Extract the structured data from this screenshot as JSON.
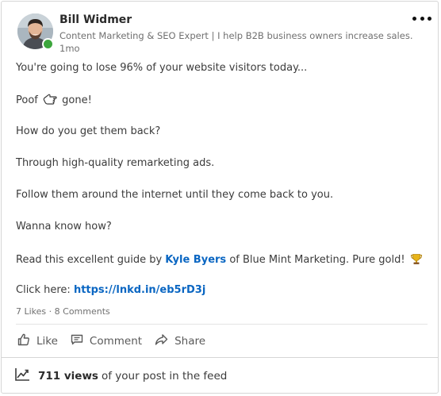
{
  "author": {
    "name": "Bill Widmer",
    "headline": "Content Marketing & SEO Expert | I help B2B business owners increase sales.",
    "time": "1mo",
    "status": "online"
  },
  "post": {
    "line1": "You're going to lose 96% of your website visitors today...",
    "line2_text": "Poof",
    "line2_icon": "backhand-index-pointing-left",
    "line2_end": "gone!",
    "line3": "How do you get them back?",
    "line4": "Through high-quality remarketing ads.",
    "line5": "Follow them around the internet until they come back to you.",
    "line6": "Wanna know how?",
    "line7_pre": "Read this excellent guide by",
    "line7_mention": "Kyle Byers",
    "line7_post": "of Blue Mint Marketing. Pure gold!",
    "line7_icon": "trophy",
    "line8_pre": "Click here:",
    "line8_link": "https://lnkd.in/eb5rD3j"
  },
  "social": {
    "likes": "7 Likes",
    "separator": "·",
    "comments": "8 Comments"
  },
  "actions": {
    "like": "Like",
    "comment": "Comment",
    "share": "Share"
  },
  "analytics": {
    "views": "711 views",
    "suffix": "of your post in the feed"
  },
  "colors": {
    "link": "#0a66c2",
    "presence": "#3da63d",
    "text": "#3b3b3b",
    "muted": "#707070"
  }
}
